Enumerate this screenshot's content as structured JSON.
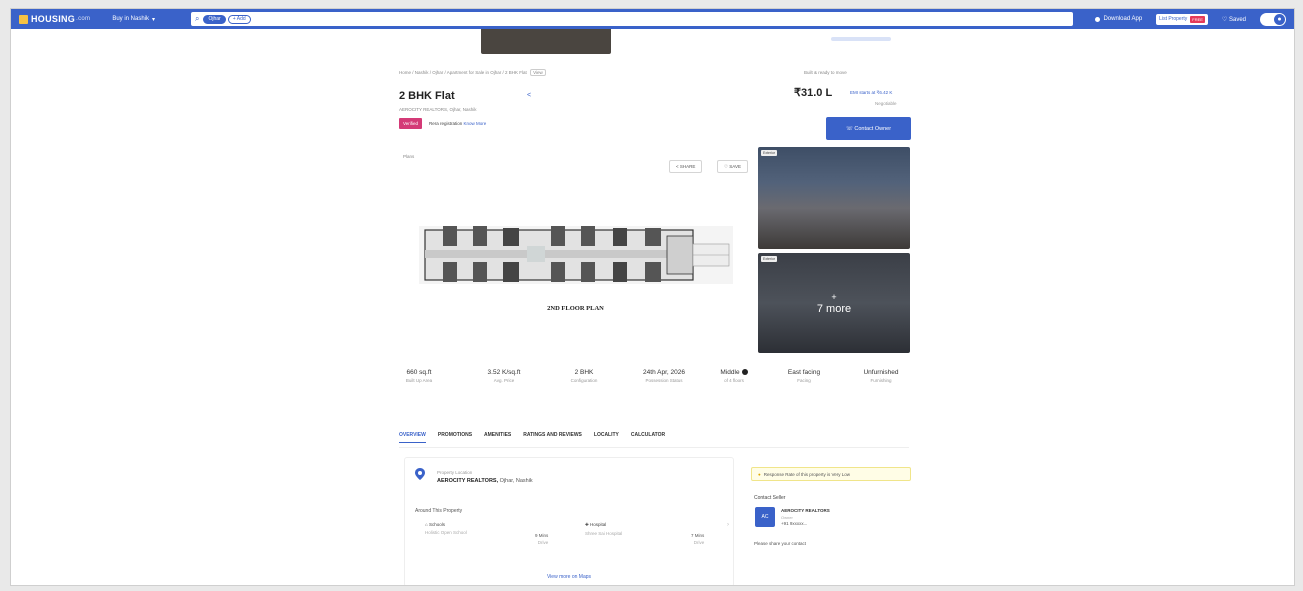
{
  "nav": {
    "logo": "HOUSING",
    "logo_suffix": ".com",
    "city": "Buy in Nashik",
    "chips": [
      {
        "label": "Ojhar",
        "selected": true
      },
      {
        "label": "+ Add",
        "selected": false
      }
    ],
    "download_app": "Download App",
    "list_property": "List Property",
    "free_badge": "FREE",
    "saved": "Saved"
  },
  "breadcrumb": "Home / Nashik / Ojhar / Apartment for Sale in Ojhar / 2 BHK Flat",
  "breadcrumb_pill": "View",
  "built_tag": "Built & ready to move",
  "listing": {
    "title": "2 BHK Flat",
    "subtitle": "AEROCITY REALTORS, Ojhar, Nashik",
    "price": "₹31.0 L",
    "emi": "EMI starts at ₹6.42 K",
    "price_sub": "Negotiable",
    "verified": "Verified",
    "rera_text": "Rera registration",
    "rera_link": "Know More",
    "contact_button": "Contact Owner"
  },
  "gallery": {
    "main_label": "Plans",
    "share_label": "SHARE",
    "save_label": "SAVE",
    "floor_caption": "2ND FLOOR PLAN",
    "thumb1_label": "Exterior",
    "thumb2_label": "Exterior",
    "more_label": "7 more"
  },
  "stats": [
    {
      "value": "660 sq.ft",
      "label": "Built Up Area"
    },
    {
      "value": "3.52 K/sq.ft",
      "label": "Avg. Price"
    },
    {
      "value": "2 BHK",
      "label": "Configuration"
    },
    {
      "value": "24th Apr, 2026",
      "label": "Possession Status"
    },
    {
      "value": "Middle",
      "label": "of 4 floors"
    },
    {
      "value": "East facing",
      "label": "Facing"
    },
    {
      "value": "Unfurnished",
      "label": "Furnishing"
    }
  ],
  "tabs": [
    "OVERVIEW",
    "PROMOTIONS",
    "AMENITIES",
    "RATINGS AND REVIEWS",
    "LOCALITY",
    "CALCULATOR"
  ],
  "overview": {
    "location_small": "Property Location",
    "location_name": "AEROCITY REALTORS,",
    "location_sub": "Ojhar, Nashik",
    "around": "Around This Property",
    "pois": [
      {
        "name": "Schools",
        "detail": "Holistic Open School",
        "time": "9 Mins",
        "time_sub": "Drive"
      },
      {
        "name": "Hospital",
        "detail": "Shree Sai Hospital",
        "time": "7 Mins",
        "time_sub": "Drive"
      }
    ],
    "view_more": "View more on Maps"
  },
  "seller": {
    "notice": "Response Rate of this property is Very Low",
    "heading": "Contact Seller",
    "avatar": "AC",
    "name": "AEROCITY REALTORS",
    "sub": "Owner",
    "phone": "+91 9xxxxx...",
    "share_prompt": "Please share your contact",
    "lang": "en"
  },
  "colors": {
    "brand": "#3a62c9",
    "verified": "#d43a77",
    "free": "#e53b5a"
  }
}
